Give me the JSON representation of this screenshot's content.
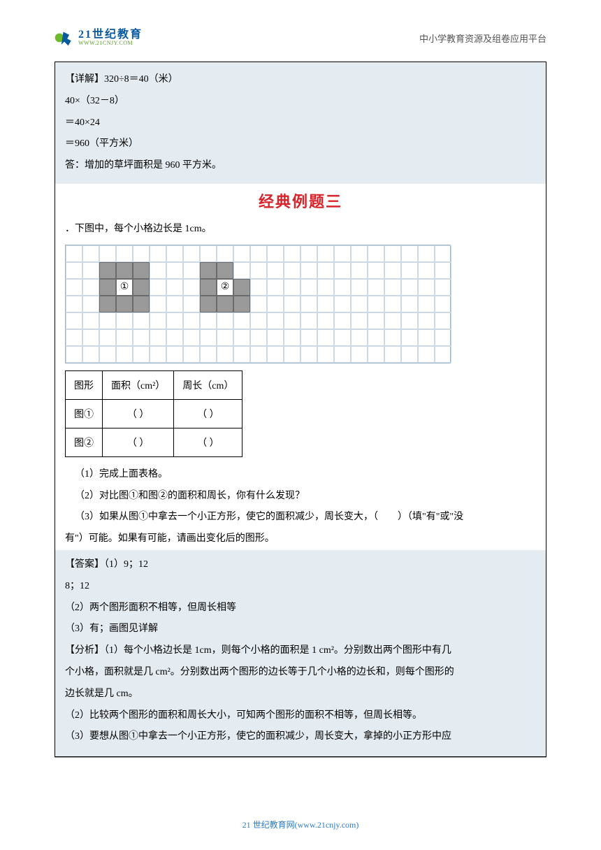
{
  "header": {
    "logo_cn": "21世纪教育",
    "logo_en": "WWW.21CNJY.COM",
    "right": "中小学教育资源及组卷应用平台"
  },
  "solution": {
    "line1": "【详解】320÷8＝40（米）",
    "line2": "40×（32－8）",
    "line3": "＝40×24",
    "line4": "＝960（平方米）",
    "line5": "答：增加的草坪面积是 960 平方米。"
  },
  "section_title": "经典例题三",
  "problem": {
    "intro": "．下图中，每个小格边长是 1cm。",
    "shape1_label": "①",
    "shape2_label": "②",
    "table": {
      "h1": "图形",
      "h2": "面积（cm²）",
      "h3": "周长（cm）",
      "r1c1": "图①",
      "r1c2": "（   ）",
      "r1c3": "（   ）",
      "r2c1": "图②",
      "r2c2": "（   ）",
      "r2c3": "（   ）"
    },
    "q1": "（1）完成上面表格。",
    "q2": "（2）对比图①和图②的面积和周长，你有什么发现？",
    "q3a": "（3）如果从图①中拿去一个小正方形，使它的面积减少，周长变大，（　　）（填\"有\"或\"没",
    "q3b": "有\"）可能。如果有可能，请画出变化后的图形。"
  },
  "answer": {
    "a_label": "【答案】（1）9；12",
    "a_line2": "8；12",
    "a2": "（2）两个图形面积不相等，但周长相等",
    "a3": "（3）有；画图见详解",
    "ana1": "【分析】（1）每个小格边长是 1cm，则每个小格的面积是 1 cm²。分别数出两个图形中有几",
    "ana2": "个小格，面积就是几 cm²。分别数出两个图形的边长等于几个小格的边长和，则每个图形的",
    "ana3": "边长就是几 cm。",
    "ana4": "（2）比较两个图形的面积和周长大小，可知两个图形的面积不相等，但周长相等。",
    "ana5": "（3）要想从图①中拿去一个小正方形，使它的面积减少，周长变大，拿掉的小正方形中应"
  },
  "footer": {
    "text": "21 世纪教育网(www.21cnjy.com)"
  }
}
